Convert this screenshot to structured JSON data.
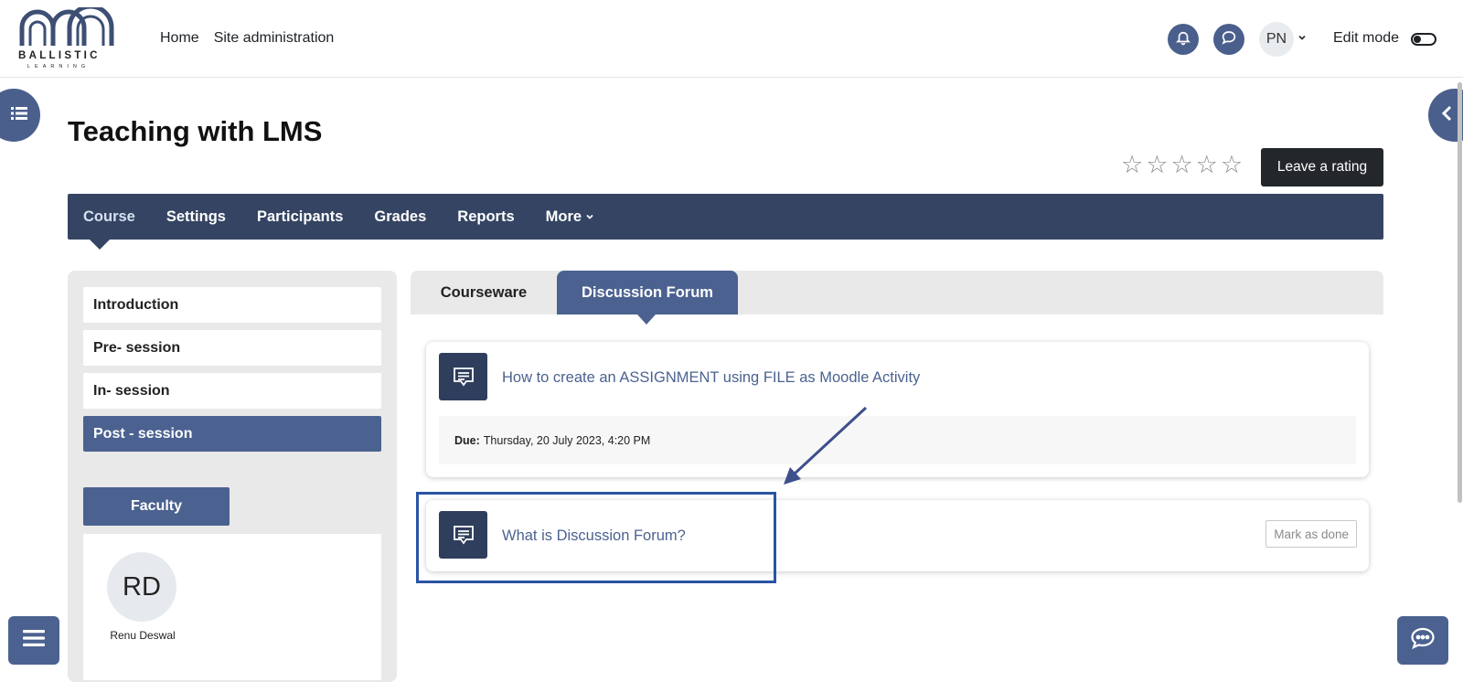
{
  "header": {
    "logo_name": "ballistic-learning-logo",
    "logo_text_top": "BALLISTIC",
    "logo_text_bottom": "LEARNING",
    "nav": [
      "Home",
      "Site administration"
    ],
    "user_initials": "PN",
    "edit_mode_label": "Edit mode"
  },
  "course": {
    "title": "Teaching with LMS",
    "rating_stars": 0,
    "rating_max": 5,
    "rating_button": "Leave a rating",
    "nav_items": [
      "Course",
      "Settings",
      "Participants",
      "Grades",
      "Reports",
      "More"
    ],
    "active_nav": "Course"
  },
  "sections": {
    "items": [
      "Introduction",
      "Pre- session",
      "In- session",
      "Post - session"
    ],
    "active": "Post - session"
  },
  "faculty": {
    "button_label": "Faculty",
    "initials": "RD",
    "name": "Renu Deswal"
  },
  "tabs": {
    "items": [
      "Courseware",
      "Discussion Forum"
    ],
    "active": "Discussion Forum"
  },
  "activities": [
    {
      "title": "How to create an ASSIGNMENT using FILE as Moodle Activity",
      "due_label": "Due:",
      "due_value": "Thursday, 20 July 2023, 4:20 PM"
    },
    {
      "title": "What is Discussion Forum?",
      "completion_button": "Mark as done"
    }
  ],
  "colors": {
    "primary": "#4b6290",
    "nav_bg": "#344462",
    "annotation": "#2a54a5"
  }
}
